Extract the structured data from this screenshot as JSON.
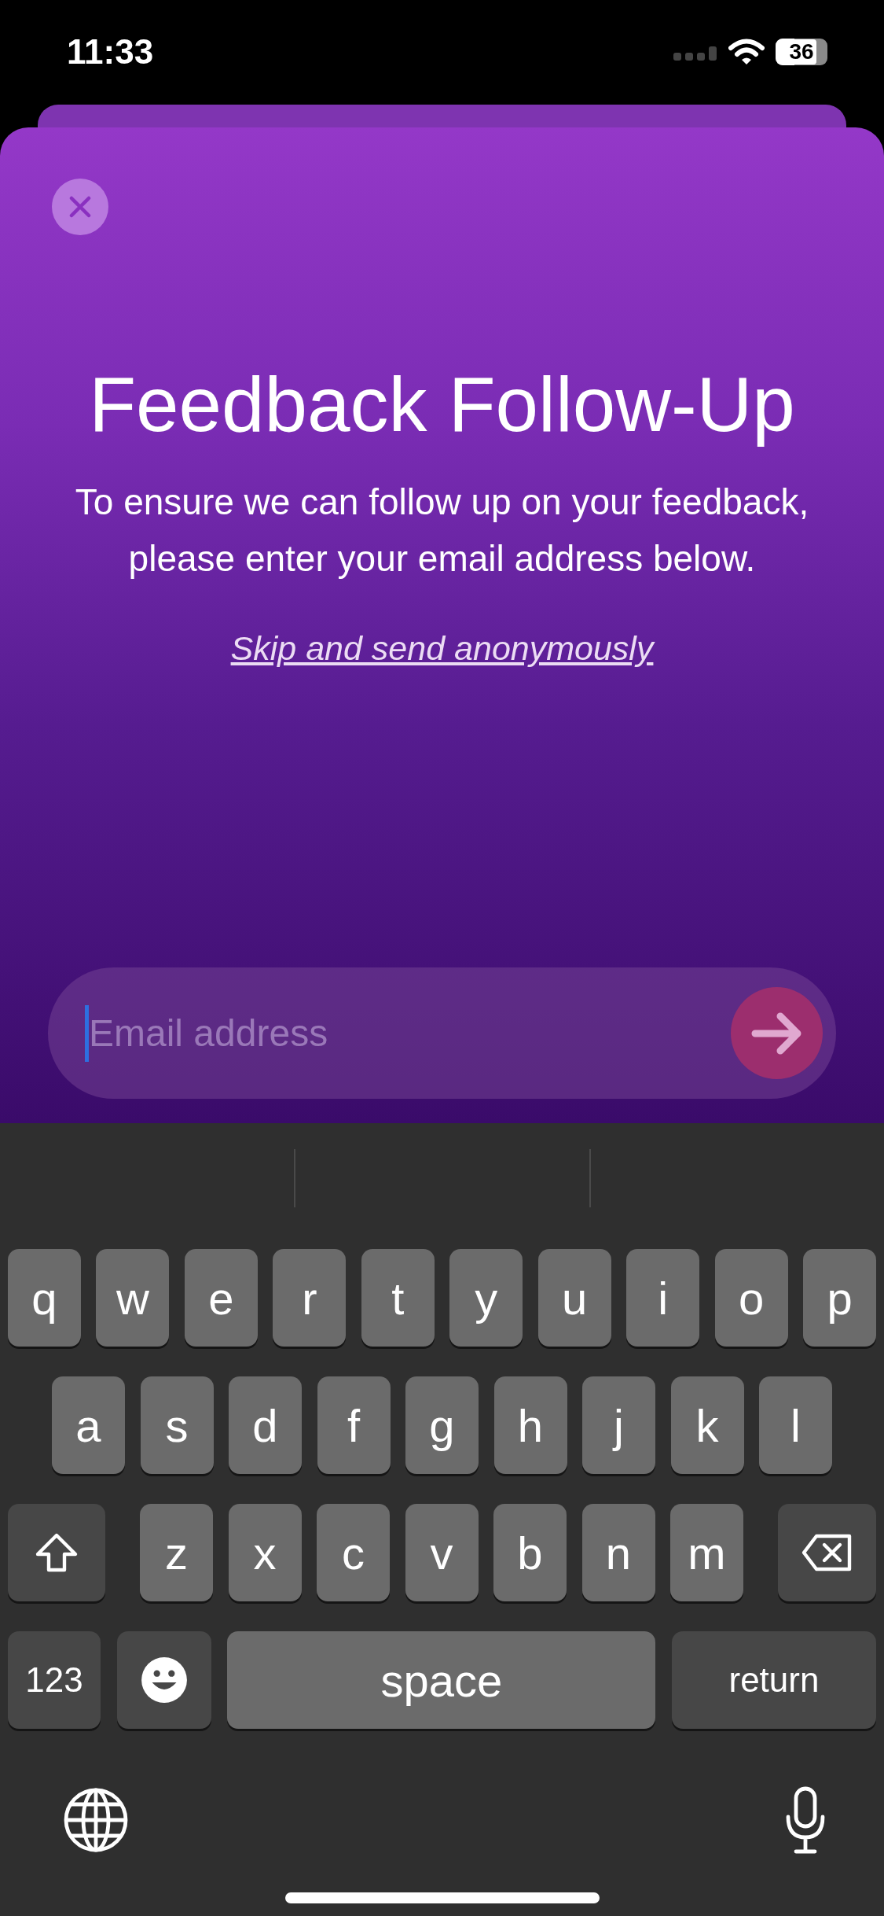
{
  "status_bar": {
    "time": "11:33",
    "battery": "36"
  },
  "sheet": {
    "title": "Feedback Follow-Up",
    "message": "To ensure we can follow up on your feedback, please enter your email address below.",
    "skip_link": "Skip and send anonymously"
  },
  "email_field": {
    "placeholder": "Email address"
  },
  "keyboard": {
    "rows": [
      [
        {
          "kind": "letter",
          "label": "q"
        },
        {
          "kind": "letter",
          "label": "w"
        },
        {
          "kind": "letter",
          "label": "e"
        },
        {
          "kind": "letter",
          "label": "r"
        },
        {
          "kind": "letter",
          "label": "t"
        },
        {
          "kind": "letter",
          "label": "y"
        },
        {
          "kind": "letter",
          "label": "u"
        },
        {
          "kind": "letter",
          "label": "i"
        },
        {
          "kind": "letter",
          "label": "o"
        },
        {
          "kind": "letter",
          "label": "p"
        }
      ],
      [
        {
          "kind": "letter",
          "label": "a"
        },
        {
          "kind": "letter",
          "label": "s"
        },
        {
          "kind": "letter",
          "label": "d"
        },
        {
          "kind": "letter",
          "label": "f"
        },
        {
          "kind": "letter",
          "label": "g"
        },
        {
          "kind": "letter",
          "label": "h"
        },
        {
          "kind": "letter",
          "label": "j"
        },
        {
          "kind": "letter",
          "label": "k"
        },
        {
          "kind": "letter",
          "label": "l"
        }
      ],
      [
        {
          "kind": "shift"
        },
        {
          "kind": "letter",
          "label": "z"
        },
        {
          "kind": "letter",
          "label": "x"
        },
        {
          "kind": "letter",
          "label": "c"
        },
        {
          "kind": "letter",
          "label": "v"
        },
        {
          "kind": "letter",
          "label": "b"
        },
        {
          "kind": "letter",
          "label": "n"
        },
        {
          "kind": "letter",
          "label": "m"
        },
        {
          "kind": "delete"
        }
      ]
    ],
    "bottom_row": [
      {
        "kind": "numbers",
        "label": "123"
      },
      {
        "kind": "emoji"
      },
      {
        "kind": "space",
        "label": "space"
      },
      {
        "kind": "return",
        "label": "return"
      }
    ]
  }
}
